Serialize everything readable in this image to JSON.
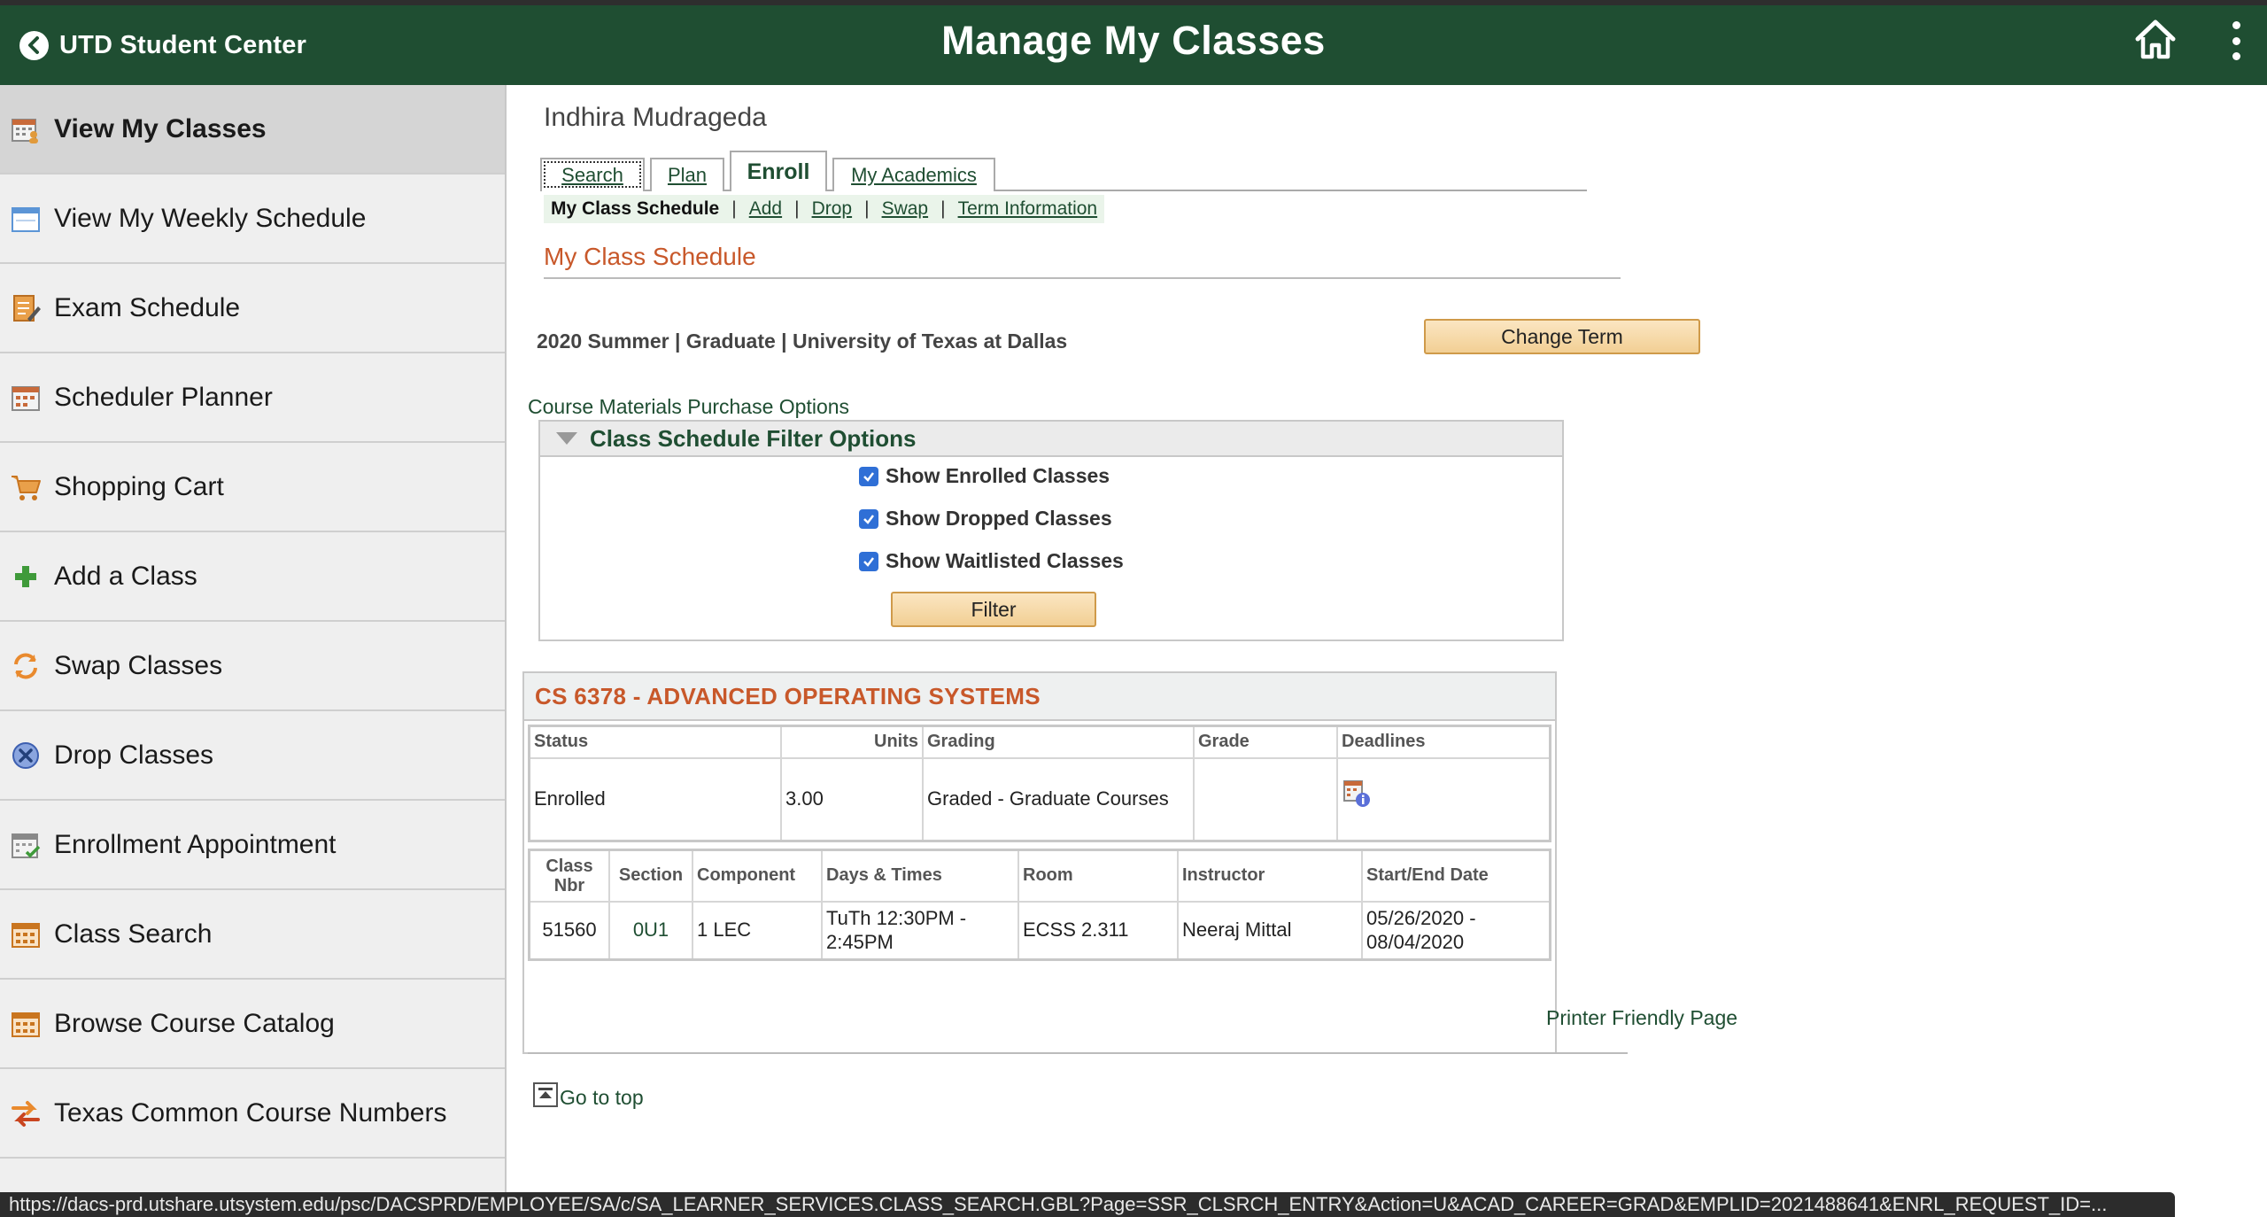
{
  "header": {
    "back_label": "UTD Student Center",
    "title": "Manage My Classes",
    "icons": {
      "back": "back-arrow-icon",
      "home": "home-icon",
      "more": "more-options-icon"
    },
    "colors": {
      "bar": "#1f4e32",
      "accent": "#c8582a"
    }
  },
  "sidebar": {
    "items": [
      {
        "label": "View My Classes",
        "icon": "calendar-person-icon",
        "active": true
      },
      {
        "label": "View My Weekly Schedule",
        "icon": "calendar-icon"
      },
      {
        "label": "Exam Schedule",
        "icon": "notepad-pencil-icon"
      },
      {
        "label": "Scheduler Planner",
        "icon": "calendar-grid-icon"
      },
      {
        "label": "Shopping Cart",
        "icon": "shopping-cart-icon"
      },
      {
        "label": "Add a Class",
        "icon": "plus-icon"
      },
      {
        "label": "Swap Classes",
        "icon": "swap-icon"
      },
      {
        "label": "Drop Classes",
        "icon": "drop-x-icon"
      },
      {
        "label": "Enrollment Appointment",
        "icon": "calendar-check-icon"
      },
      {
        "label": "Class Search",
        "icon": "calendar-search-icon"
      },
      {
        "label": "Browse Course Catalog",
        "icon": "catalog-icon"
      },
      {
        "label": "Texas Common Course Numbers",
        "icon": "transfer-arrows-icon"
      }
    ]
  },
  "main": {
    "student_name": "Indhira Mudrageda",
    "tabs": [
      {
        "label": "Search"
      },
      {
        "label": "Plan"
      },
      {
        "label": "Enroll",
        "active": true
      },
      {
        "label": "My Academics"
      }
    ],
    "subtabs": [
      {
        "label": "My Class Schedule",
        "current": true
      },
      {
        "label": "Add"
      },
      {
        "label": "Drop"
      },
      {
        "label": "Swap"
      },
      {
        "label": "Term Information"
      }
    ],
    "section_title": "My Class Schedule",
    "term_text": "2020 Summer | Graduate | University of Texas at Dallas",
    "change_term_label": "Change Term",
    "course_materials_link": "Course Materials Purchase Options",
    "filter": {
      "title": "Class Schedule Filter Options",
      "options": [
        {
          "label": "Show Enrolled Classes",
          "checked": true
        },
        {
          "label": "Show Dropped Classes",
          "checked": true
        },
        {
          "label": "Show Waitlisted Classes",
          "checked": true
        }
      ],
      "button_label": "Filter"
    },
    "course": {
      "title": "CS 6378 - ADVANCED OPERATING SYSTEMS",
      "summary_headers": {
        "status": "Status",
        "units": "Units",
        "grading": "Grading",
        "grade": "Grade",
        "deadlines": "Deadlines"
      },
      "summary_row": {
        "status": "Enrolled",
        "units": "3.00",
        "grading": "Graded - Graduate Courses",
        "grade": "",
        "deadlines_icon": "deadlines-calendar-icon"
      },
      "section_headers": {
        "class_nbr": "Class Nbr",
        "section": "Section",
        "component": "Component",
        "days_times": "Days & Times",
        "room": "Room",
        "instructor": "Instructor",
        "start_end": "Start/End Date"
      },
      "section_row": {
        "class_nbr": "51560",
        "section": "0U1",
        "component": "1 LEC",
        "days_times": "TuTh 12:30PM - 2:45PM",
        "room": "ECSS 2.311",
        "instructor": "Neeraj Mittal",
        "start_end": "05/26/2020 - 08/04/2020"
      }
    },
    "printer_friendly": "Printer Friendly Page",
    "go_to_top": "Go to top"
  },
  "status_url": "https://dacs-prd.utshare.utsystem.edu/psc/DACSPRD/EMPLOYEE/SA/c/SA_LEARNER_SERVICES.CLASS_SEARCH.GBL?Page=SSR_CLSRCH_ENTRY&Action=U&ACAD_CAREER=GRAD&EMPLID=2021488641&ENRL_REQUEST_ID=..."
}
